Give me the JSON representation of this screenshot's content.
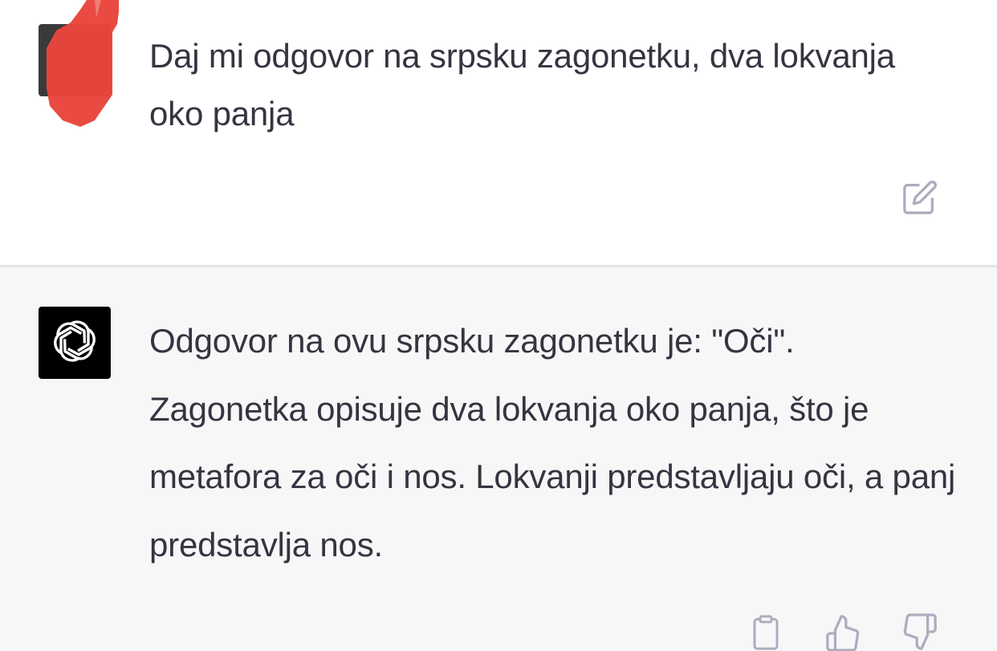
{
  "conversation": {
    "user_message": {
      "text": "Daj mi odgovor na srpsku zagonetku, dva lokvanja oko panja",
      "avatar_icon": "user-avatar-redacted"
    },
    "assistant_message": {
      "text": "Odgovor na ovu srpsku zagonetku je: \"Oči\". Zagonetka opisuje dva lokvanja oko panja, što je metafora za oči i nos. Lokvanji predstavljaju oči, a panj predstavlja nos.",
      "avatar_icon": "openai-logo-icon"
    }
  },
  "actions": {
    "edit_icon": "edit-icon",
    "copy_icon": "clipboard-icon",
    "thumbs_up_icon": "thumbs-up-icon",
    "thumbs_down_icon": "thumbs-down-icon"
  },
  "colors": {
    "user_bg": "#ffffff",
    "assistant_bg": "#f7f7f8",
    "text": "#343541",
    "icon": "#acacbe",
    "redaction": "#e8453c"
  }
}
